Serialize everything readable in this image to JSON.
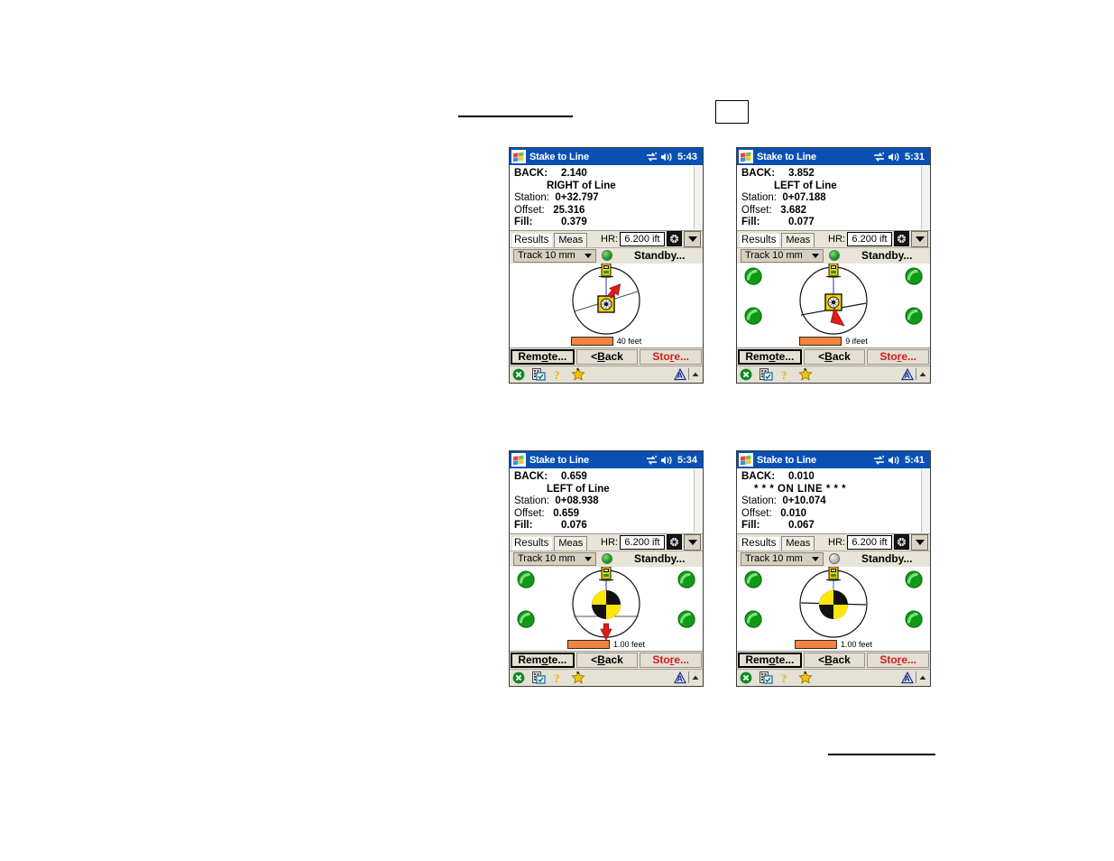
{
  "page": {
    "header_rule": true,
    "header_box": true,
    "footer_rule": true
  },
  "common": {
    "app_title": "Stake to Line",
    "win_logo_icon": "windows-flag-icon",
    "connectivity_icon": "connectivity-icon",
    "volume_icon": "speaker-icon",
    "tabs": {
      "results": "Results",
      "meas": "Meas"
    },
    "hr_label": "HR:",
    "hr_value": "6.200 ift",
    "hr_target_icon": "target-prism-icon",
    "dropdown_icon": "chevron-down-icon",
    "track_mode": "Track 10 mm",
    "status_text": "Standby...",
    "labels": {
      "back": "BACK:",
      "station": "Station:",
      "offset": "Offset:",
      "fill": "Fill:"
    },
    "buttons": {
      "remote": "Remote...",
      "back": "< Back",
      "store": "Store..."
    },
    "taskbar_icons": [
      "close-circle-icon",
      "properties-icon",
      "help-icon",
      "favorites-star-icon",
      "survey-app-icon",
      "scroll-up-icon"
    ],
    "colors": {
      "titlebar": "#0a50b4",
      "chrome": "#e8e4d8",
      "scalebar": "#f5843c",
      "store_text": "#d21b1b",
      "status_green": "#0f9e17",
      "status_grey": "#b8b8b8",
      "target_yellow": "#ffe600",
      "arrow_red": "#e01b1b"
    }
  },
  "panels": [
    {
      "id": "panel-1",
      "time": "5:43",
      "back_value": "2.140",
      "direction": "RIGHT of Line",
      "station_value": "0+32.797",
      "offset_value": "25.316",
      "fill_value": "0.379",
      "status_dot": "green",
      "scale_label": "40 feet",
      "corner_lights": "none",
      "graphic": {
        "target_style": "small-prism",
        "arrow": "up-right",
        "instrument_icon": "total-station-icon",
        "chord_line": true
      }
    },
    {
      "id": "panel-2",
      "time": "5:31",
      "back_value": "3.852",
      "direction": "LEFT of Line",
      "station_value": "0+07.188",
      "offset_value": "3.682",
      "fill_value": "0.077",
      "status_dot": "green",
      "scale_label": "9 ifeet",
      "corner_lights": "four-green",
      "graphic": {
        "target_style": "small-prism",
        "arrow": "down",
        "instrument_icon": "total-station-icon",
        "chord_line": true
      }
    },
    {
      "id": "panel-3",
      "time": "5:34",
      "back_value": "0.659",
      "direction": "LEFT of Line",
      "station_value": "0+08.938",
      "offset_value": "0.659",
      "fill_value": "0.076",
      "status_dot": "green",
      "scale_label": "1.00 feet",
      "corner_lights": "four-green",
      "graphic": {
        "target_style": "big-bullseye",
        "arrow": "down",
        "instrument_icon": "total-station-icon",
        "chord_line": true
      }
    },
    {
      "id": "panel-4",
      "time": "5:41",
      "back_value": "0.010",
      "direction": "* * * ON LINE * * *",
      "station_value": "0+10.074",
      "offset_value": "0.010",
      "fill_value": "0.067",
      "status_dot": "grey",
      "scale_label": "1.00 feet",
      "corner_lights": "four-green",
      "graphic": {
        "target_style": "big-bullseye",
        "arrow": "none",
        "instrument_icon": "total-station-icon",
        "chord_line": true
      }
    }
  ]
}
